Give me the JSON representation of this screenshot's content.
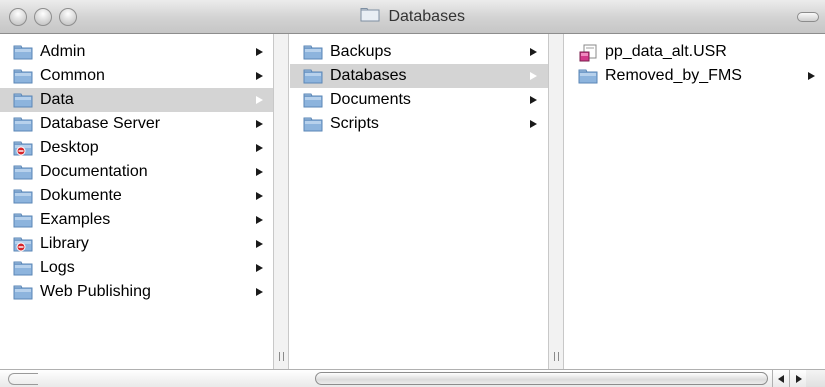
{
  "window": {
    "title": "Databases"
  },
  "columns": {
    "col1": [
      {
        "label": "Admin",
        "icon": "folder-icon",
        "arrow": true
      },
      {
        "label": "Common",
        "icon": "folder-icon",
        "arrow": true
      },
      {
        "label": "Data",
        "icon": "folder-icon",
        "arrow": true,
        "selected": true
      },
      {
        "label": "Database Server",
        "icon": "folder-icon",
        "arrow": true
      },
      {
        "label": "Desktop",
        "icon": "restricted-folder-icon",
        "arrow": true
      },
      {
        "label": "Documentation",
        "icon": "folder-icon",
        "arrow": true
      },
      {
        "label": "Dokumente",
        "icon": "folder-icon",
        "arrow": true
      },
      {
        "label": "Examples",
        "icon": "folder-icon",
        "arrow": true
      },
      {
        "label": "Library",
        "icon": "restricted-folder-icon",
        "arrow": true
      },
      {
        "label": "Logs",
        "icon": "folder-icon",
        "arrow": true
      },
      {
        "label": "Web Publishing",
        "icon": "folder-icon",
        "arrow": true
      }
    ],
    "col2": [
      {
        "label": "Backups",
        "icon": "folder-icon",
        "arrow": true
      },
      {
        "label": "Databases",
        "icon": "folder-icon",
        "arrow": true,
        "selected": true
      },
      {
        "label": "Documents",
        "icon": "folder-icon",
        "arrow": true
      },
      {
        "label": "Scripts",
        "icon": "folder-icon",
        "arrow": true
      }
    ],
    "col3": [
      {
        "label": "pp_data_alt.USR",
        "icon": "filemaker-file-icon",
        "arrow": false
      },
      {
        "label": "Removed_by_FMS",
        "icon": "folder-icon",
        "arrow": true
      }
    ]
  },
  "colors": {
    "selection": "#d4d4d4",
    "folder": "#7fa9d6",
    "restricted_badge": "#d6242a"
  }
}
